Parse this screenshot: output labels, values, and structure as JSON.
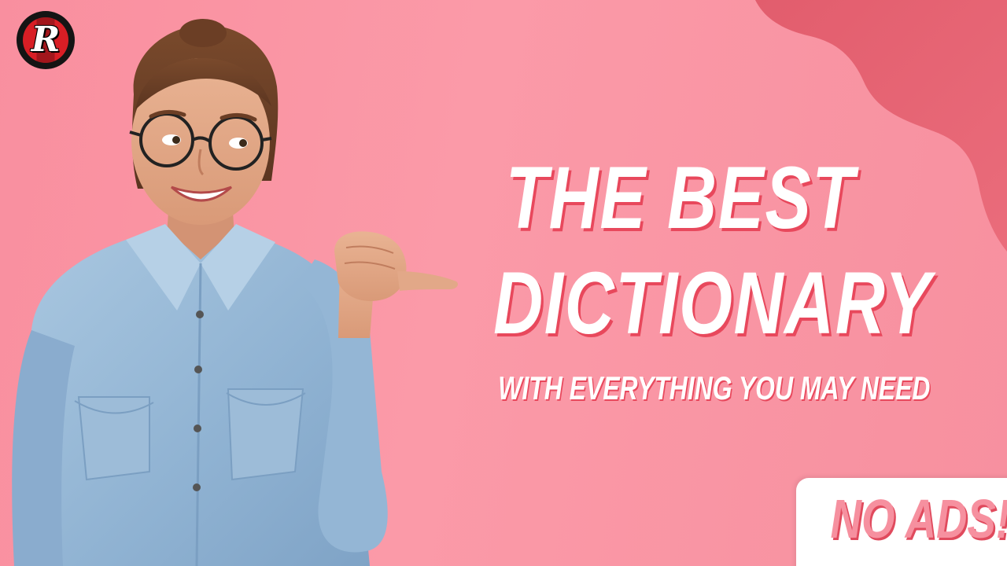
{
  "logo": {
    "letter": "R"
  },
  "headline": {
    "line1": "THE BEST",
    "line2": "DICTIONARY"
  },
  "subheadline": "WITH EVERYTHING YOU MAY NEED",
  "badge": {
    "label": "NO ADS!"
  },
  "colors": {
    "background": "#f98f9f",
    "accent_blob": "#e46171",
    "text_shadow": "#e8485c",
    "badge_text": "#f6909f",
    "logo_red": "#d81e25"
  },
  "icons": [
    "logo-r-icon"
  ]
}
